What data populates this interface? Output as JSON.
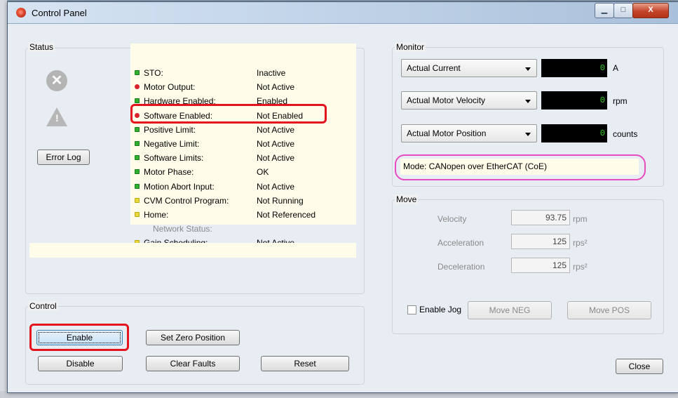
{
  "window": {
    "title": "Control Panel"
  },
  "window_buttons": {
    "minimize": "▁",
    "maximize": "□",
    "close": "X"
  },
  "status": {
    "group_label": "Status",
    "error_log_button": "Error Log",
    "rows": [
      {
        "label": "STO:",
        "value": "Inactive",
        "indicator": "green"
      },
      {
        "label": "Motor Output:",
        "value": "Not Active",
        "indicator": "red"
      },
      {
        "label": "Hardware Enabled:",
        "value": "Enabled",
        "indicator": "green"
      },
      {
        "label": "Software Enabled:",
        "value": "Not Enabled",
        "indicator": "red"
      },
      {
        "label": "Positive Limit:",
        "value": "Not Active",
        "indicator": "green"
      },
      {
        "label": "Negative Limit:",
        "value": "Not Active",
        "indicator": "green"
      },
      {
        "label": "Software Limits:",
        "value": "Not Active",
        "indicator": "green"
      },
      {
        "label": "Motor Phase:",
        "value": "OK",
        "indicator": "green"
      },
      {
        "label": "Motion Abort Input:",
        "value": "Not Active",
        "indicator": "green"
      },
      {
        "label": "CVM Control Program:",
        "value": "Not Running",
        "indicator": "yellow"
      },
      {
        "label": "Home:",
        "value": "Not Referenced",
        "indicator": "yellow"
      },
      {
        "label": "Network Status:",
        "value": "",
        "indicator": "none"
      },
      {
        "label": "Gain Scheduling:",
        "value": "Not Active",
        "indicator": "yellow"
      }
    ]
  },
  "control": {
    "group_label": "Control",
    "enable": "Enable",
    "set_zero_position": "Set Zero Position",
    "disable": "Disable",
    "clear_faults": "Clear Faults",
    "reset": "Reset"
  },
  "monitor": {
    "group_label": "Monitor",
    "channels": [
      {
        "selected": "Actual Current",
        "value": "0",
        "unit": "A"
      },
      {
        "selected": "Actual Motor Velocity",
        "value": "0",
        "unit": "rpm"
      },
      {
        "selected": "Actual Motor Position",
        "value": "0",
        "unit": "counts"
      }
    ],
    "mode": "Mode:  CANopen over EtherCAT (CoE)"
  },
  "move": {
    "group_label": "Move",
    "velocity_label": "Velocity",
    "velocity_value": "93.75",
    "velocity_unit": "rpm",
    "acceleration_label": "Acceleration",
    "acceleration_value": "125",
    "acceleration_unit": "rps²",
    "deceleration_label": "Deceleration",
    "deceleration_value": "125",
    "deceleration_unit": "rps²",
    "enable_jog_label": "Enable Jog",
    "enable_jog_checked": false,
    "move_neg": "Move NEG",
    "move_pos": "Move POS"
  },
  "footer": {
    "close": "Close"
  },
  "colors": {
    "highlight_red": "#e3141d",
    "highlight_pink": "#e94cc1",
    "readout_text": "#3ad02a",
    "panel_yellow": "#fffde9"
  }
}
